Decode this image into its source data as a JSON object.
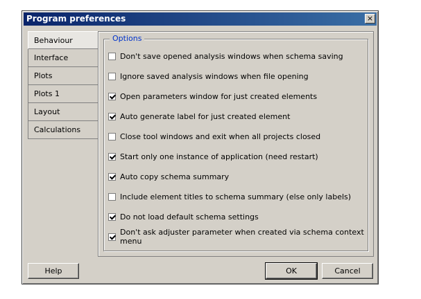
{
  "window": {
    "title": "Program preferences",
    "close_glyph": "×"
  },
  "tabs": [
    "Behaviour",
    "Interface",
    "Plots",
    "Plots 1",
    "Layout",
    "Calculations"
  ],
  "active_tab": "Behaviour",
  "group": {
    "legend": "Options"
  },
  "options": [
    {
      "label": "Don't save opened analysis windows when schema saving",
      "checked": false
    },
    {
      "label": "Ignore saved analysis windows when file opening",
      "checked": false
    },
    {
      "label": "Open parameters window for just created elements",
      "checked": true
    },
    {
      "label": "Auto generate label for just created element",
      "checked": true
    },
    {
      "label": "Close tool windows and exit when all projects closed",
      "checked": false
    },
    {
      "label": "Start only one instance of application (need restart)",
      "checked": true
    },
    {
      "label": "Auto copy schema summary",
      "checked": true
    },
    {
      "label": "Include element titles to schema summary (else only labels)",
      "checked": false
    },
    {
      "label": "Do not load default schema settings",
      "checked": true
    },
    {
      "label": "Don't ask adjuster parameter when created via schema context menu",
      "checked": true
    }
  ],
  "buttons": {
    "help": "Help",
    "ok": "OK",
    "cancel": "Cancel"
  }
}
